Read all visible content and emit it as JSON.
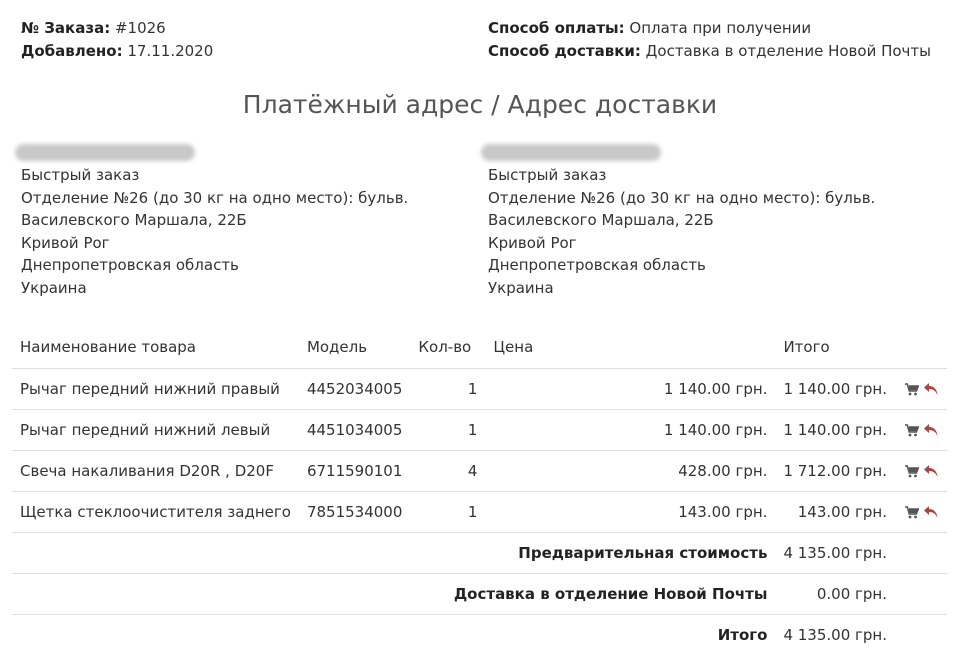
{
  "order": {
    "number_label": "№ Заказа:",
    "number_value": "#1026",
    "added_label": "Добавлено:",
    "added_value": "17.11.2020",
    "payment_label": "Способ оплаты:",
    "payment_value": "Оплата при получении",
    "shipping_label": "Способ доставки:",
    "shipping_value": "Доставка в отделение Новой Почты"
  },
  "addresses": {
    "title": "Платёжный адрес / Адрес доставки",
    "payment": {
      "lines": [
        "Быстрый заказ",
        "Отделение №26 (до 30 кг на одно место): бульв.",
        "Василевского Маршала, 22Б",
        "Кривой Рог",
        "Днепропетровская область",
        "Украина"
      ]
    },
    "shipping": {
      "lines": [
        "Быстрый заказ",
        "Отделение №26 (до 30 кг на одно место): бульв.",
        "Василевского Маршала, 22Б",
        "Кривой Рог",
        "Днепропетровская область",
        "Украина"
      ]
    }
  },
  "table": {
    "headers": {
      "name": "Наименование товара",
      "model": "Модель",
      "qty": "Кол-во",
      "price": "Цена",
      "total": "Итого"
    },
    "rows": [
      {
        "name": "Рычаг передний нижний правый",
        "model": "4452034005",
        "qty": "1",
        "price": "1 140.00 грн.",
        "total": "1 140.00 грн."
      },
      {
        "name": "Рычаг передний нижний левый",
        "model": "4451034005",
        "qty": "1",
        "price": "1 140.00 грн.",
        "total": "1 140.00 грн."
      },
      {
        "name": "Свеча накаливания D20R , D20F",
        "model": "6711590101",
        "qty": "4",
        "price": "428.00 грн.",
        "total": "1 712.00 грн."
      },
      {
        "name": "Щетка стеклоочистителя заднего",
        "model": "7851534000",
        "qty": "1",
        "price": "143.00 грн.",
        "total": "143.00 грн."
      }
    ],
    "totals": [
      {
        "label": "Предварительная стоимость",
        "value": "4 135.00 грн."
      },
      {
        "label": "Доставка в отделение Новой Почты",
        "value": "0.00 грн."
      },
      {
        "label": "Итого",
        "value": "4 135.00 грн."
      }
    ]
  },
  "icons": {
    "reorder": "cart-icon",
    "return": "return-icon"
  },
  "colors": {
    "cart_icon": "#555555",
    "return_icon": "#a94442",
    "border": "#dddddd"
  }
}
